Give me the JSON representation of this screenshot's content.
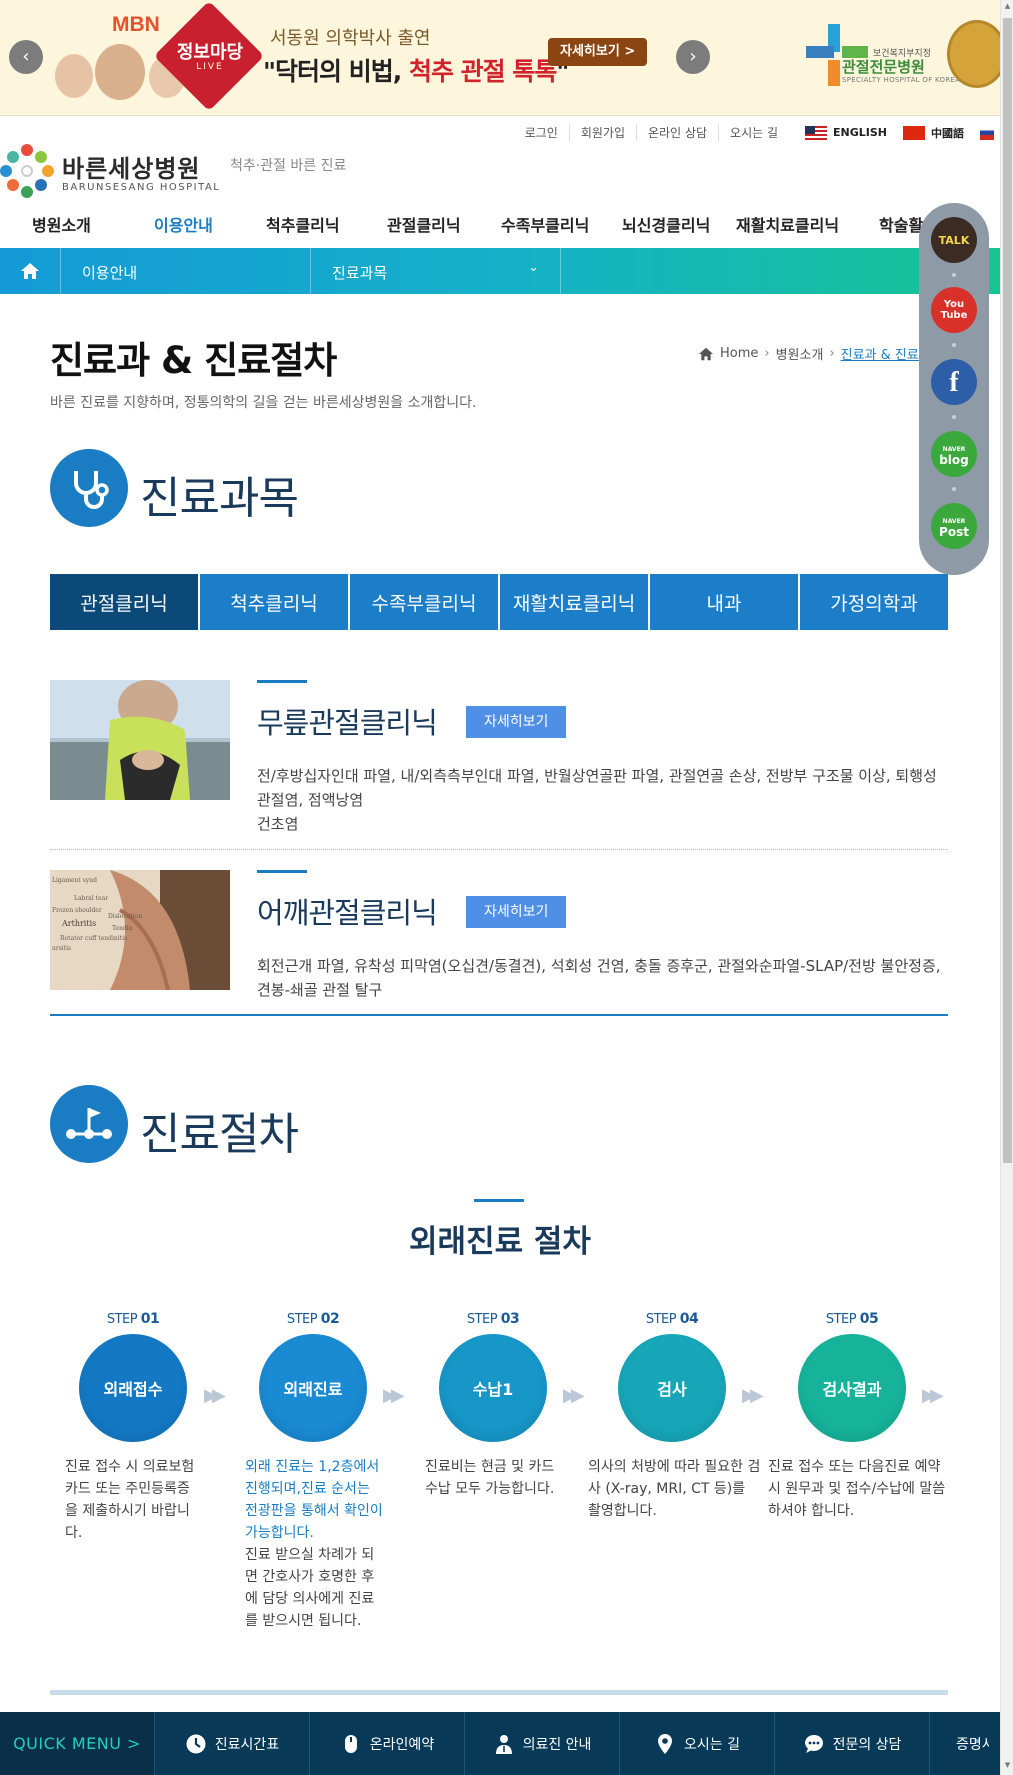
{
  "banner": {
    "mbn": "MBN",
    "badge_title": "정보마당",
    "badge_sub": "LIVE",
    "line1": "서동원 의학박사 출연",
    "line2_pre": "\"닥터의 비법, ",
    "line2_hl": "척추 관절 톡톡",
    "line2_post": "\"",
    "more_label": "자세히보기 >",
    "hospital_small": "보건복지부지정",
    "hospital_big": "관절전문병원",
    "hospital_en": "SPECIALTY HOSPITAL OF KOREA"
  },
  "util": {
    "links": [
      "로그인",
      "회원가입",
      "온라인 상담",
      "오시는 길"
    ],
    "lang_en": "ENGLISH",
    "lang_cn": "中國語"
  },
  "logo": {
    "kr": "바른세상병원",
    "en": "BARUNSESANG HOSPITAL",
    "tagline": "척추·관절 바른 진료"
  },
  "gnb": [
    "병원소개",
    "이용안내",
    "척추클리닉",
    "관절클리닉",
    "수족부클리닉",
    "뇌신경클리닉",
    "재활치료클리닉",
    "학술활동"
  ],
  "subbar": {
    "current": "이용안내",
    "dropdown": "진료과목",
    "chevron": "⌄"
  },
  "page": {
    "title": "진료과 & 진료절차",
    "desc": "바른 진료를 지향하며, 정통의학의 길을 걷는 바른세상병원을 소개합니다.",
    "crumb": [
      "Home",
      "병원소개",
      "진료과 & 진료절차"
    ]
  },
  "section1": {
    "title": "진료과목"
  },
  "tabs": [
    "관절클리닉",
    "척추클리닉",
    "수족부클리닉",
    "재활치료클리닉",
    "내과",
    "가정의학과"
  ],
  "clinics": [
    {
      "name": "무릎관절클리닉",
      "btn": "자세히보기",
      "desc": "전/후방십자인대 파열, 내/외측측부인대 파열, 반월상연골판 파열, 관절연골 손상, 전방부 구조물 이상, 퇴행성 관절염, 점액낭염",
      "desc2": "건초염"
    },
    {
      "name": "어깨관절클리닉",
      "btn": "자세히보기",
      "desc": "회전근개 파열, 유착성 피막염(오십견/동결견), 석회성 건염, 충돌 증후군, 관절와순파열-SLAP/전방 불안정증, 견봉-쇄골 관절 탈구",
      "thumb_words": [
        "Ligament synd",
        "Labral tear",
        "Frozen shoulder",
        "Dislocation",
        "Arthritis",
        "Tendin",
        "Rotator cuff tendinitis",
        "ursitis"
      ]
    }
  ],
  "section2": {
    "title": "진료절차"
  },
  "process": {
    "title": "외래진료 절차",
    "steps": [
      {
        "label": "STEP",
        "num": "01",
        "name": "외래접수",
        "color": "#1479c4",
        "text": "진료 접수 시 의료보험카드 또는 주민등록증을 제출하시기 바랍니다."
      },
      {
        "label": "STEP",
        "num": "02",
        "name": "외래진료",
        "color": "#1a8ad3",
        "text_blue": "외래 진료는 1,2층에서 진행되며,진료 순서는 전광판을 통해서 확인이 가능합니다.",
        "text": "진료 받으실 차례가 되면 간호사가 호명한 후에 담당 의사에게 진료를 받으시면 됩니다."
      },
      {
        "label": "STEP",
        "num": "03",
        "name": "수납1",
        "color": "#1796c8",
        "text": "진료비는 현금 및 카드 수납 모두 가능합니다."
      },
      {
        "label": "STEP",
        "num": "04",
        "name": "검사",
        "color": "#17a6b8",
        "text": "의사의 처방에 따라 필요한 검사 (X-ray, MRI, CT 등)를 촬영합니다."
      },
      {
        "label": "STEP",
        "num": "05",
        "name": "검사결과",
        "color": "#16b39a",
        "text": "진료 접수 또는 다음진료 예약 시 원무과 및 접수/수납에 말씀하셔야 합니다."
      }
    ]
  },
  "quick": {
    "title": "QUICK MENU  >",
    "items": [
      "진료시간표",
      "온라인예약",
      "의료진 안내",
      "오시는 길",
      "전문의 상담",
      "증명서"
    ]
  },
  "side": {
    "talk": "TALK",
    "youtube_1": "You",
    "youtube_2": "Tube",
    "facebook": "f",
    "blog_1": "NAVER",
    "blog_2": "blog",
    "post_1": "NAVER",
    "post_2": "Post"
  },
  "colors": {
    "primary": "#1a7cc3",
    "dark": "#0b4a78",
    "navy": "#1a3a5c",
    "quick_bg": "#083a57",
    "quick_accent": "#23d0b9"
  }
}
